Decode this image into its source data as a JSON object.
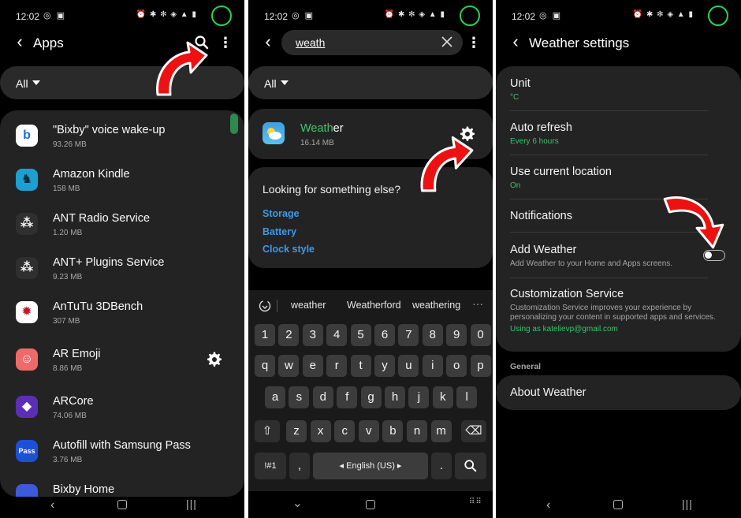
{
  "status": {
    "time": "12:02",
    "notif_glyphs": "◎ ▣",
    "system_glyphs": "⏰ ✱ ✻ ◈ ▲ ▮"
  },
  "panel1": {
    "title": "Apps",
    "filter": "All",
    "apps": [
      {
        "name": "\"Bixby\" voice wake-up",
        "size": "93.26 MB",
        "icon_color": "#ffffff",
        "icon_fg": "#1e6fe0",
        "glyph": "b"
      },
      {
        "name": "Amazon Kindle",
        "size": "158 MB",
        "icon_color": "#1e9fd1",
        "icon_fg": "#0b2a3a",
        "glyph": "♞"
      },
      {
        "name": "ANT Radio Service",
        "size": "1.20 MB",
        "icon_color": "#2f2f2f",
        "icon_fg": "#ffffff",
        "glyph": "⁂"
      },
      {
        "name": "ANT+ Plugins Service",
        "size": "9.23 MB",
        "icon_color": "#2f2f2f",
        "icon_fg": "#ffffff",
        "glyph": "⁂"
      },
      {
        "name": "AnTuTu 3DBench",
        "size": "307 MB",
        "icon_color": "#ffffff",
        "icon_fg": "#c0182b",
        "glyph": "✹"
      },
      {
        "name": "AR Emoji",
        "size": "8.86 MB",
        "icon_color": "#ee6a6a",
        "icon_fg": "#ffffff",
        "glyph": "☺"
      },
      {
        "name": "ARCore",
        "size": "74.06 MB",
        "icon_color": "#5b2fb3",
        "icon_fg": "#ffffff",
        "glyph": "◆"
      },
      {
        "name": "Autofill with Samsung Pass",
        "size": "3.76 MB",
        "icon_color": "#1e4fd8",
        "icon_fg": "#ffffff",
        "glyph": "Pass"
      },
      {
        "name": "Bixby Home",
        "size": "",
        "icon_color": "#3b5bdb",
        "icon_fg": "#ffffff",
        "glyph": ""
      }
    ]
  },
  "panel2": {
    "query": "weath",
    "result": {
      "match": "Weath",
      "rest": "er",
      "size": "16.14 MB"
    },
    "suggest_title": "Looking for something else?",
    "links": [
      "Storage",
      "Battery",
      "Clock style"
    ],
    "kb_suggestions": [
      "weather",
      "Weatherford",
      "weathering"
    ],
    "kb_rows": [
      [
        "1",
        "2",
        "3",
        "4",
        "5",
        "6",
        "7",
        "8",
        "9",
        "0"
      ],
      [
        "q",
        "w",
        "e",
        "r",
        "t",
        "y",
        "u",
        "i",
        "o",
        "p"
      ],
      [
        "a",
        "s",
        "d",
        "f",
        "g",
        "h",
        "j",
        "k",
        "l"
      ],
      [
        "⇧",
        "z",
        "x",
        "c",
        "v",
        "b",
        "n",
        "m",
        "⌫"
      ]
    ],
    "kb_bottom": {
      "sym": "!#1",
      "comma": ",",
      "space": "◂ English (US) ▸",
      "period": "."
    }
  },
  "panel3": {
    "title": "Weather settings",
    "items": [
      {
        "title": "Unit",
        "sub": "°C"
      },
      {
        "title": "Auto refresh",
        "sub": "Every 6 hours"
      },
      {
        "title": "Use current location",
        "sub": "On"
      },
      {
        "title": "Notifications"
      },
      {
        "title": "Add Weather",
        "desc": "Add Weather to your Home and Apps screens."
      },
      {
        "title": "Customization Service",
        "desc": "Customization Service improves your experience by personalizing your content in supported apps and services.",
        "sub": "Using as katelievp@gmail.com"
      }
    ],
    "add_weather_enabled": false,
    "section": "General",
    "about": "About Weather"
  },
  "colors": {
    "accent": "#43c46b",
    "link": "#3d9ae8",
    "arrow": "#ee1111",
    "card": "#232323"
  }
}
